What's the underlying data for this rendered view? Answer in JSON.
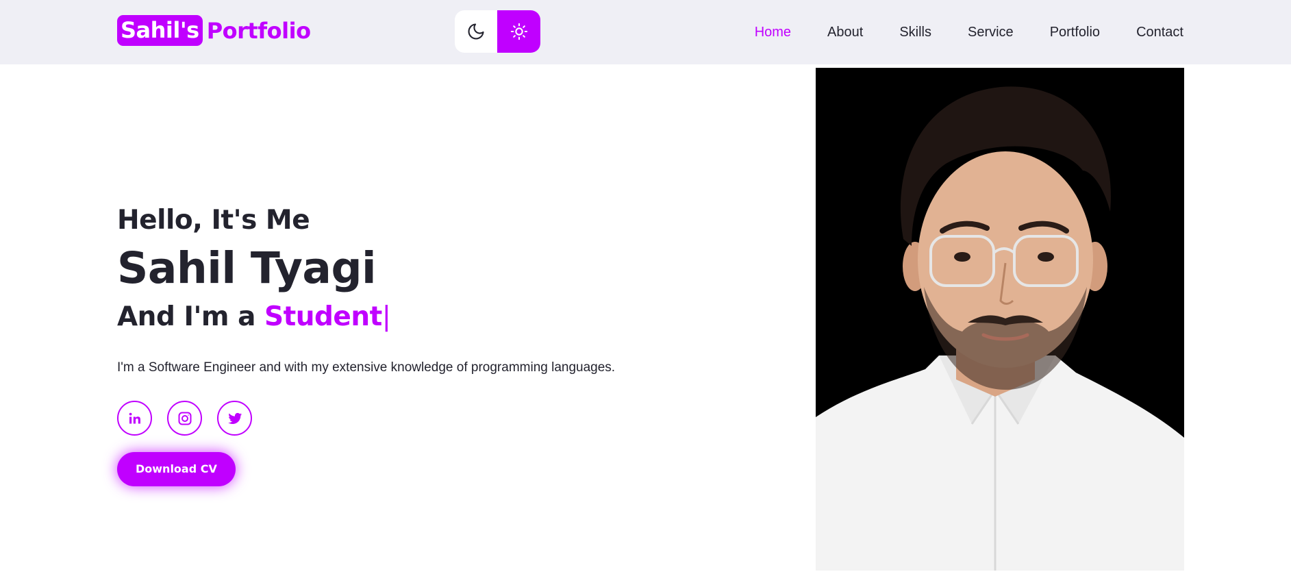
{
  "header": {
    "logo_badge": "Sahil's",
    "logo_text": "Portfolio",
    "theme_toggle": {
      "dark_icon": "moon-icon",
      "light_icon": "sun-icon",
      "active": "light"
    },
    "nav": [
      {
        "label": "Home",
        "active": true
      },
      {
        "label": "About",
        "active": false
      },
      {
        "label": "Skills",
        "active": false
      },
      {
        "label": "Service",
        "active": false
      },
      {
        "label": "Portfolio",
        "active": false
      },
      {
        "label": "Contact",
        "active": false
      }
    ]
  },
  "hero": {
    "greeting": "Hello, It's Me",
    "name": "Sahil Tyagi",
    "role_prefix": "And I'm a",
    "role_highlight": "Student",
    "description": "I'm a Software Engineer and with my extensive knowledge of programming languages.",
    "socials": [
      {
        "icon": "linkedin-icon"
      },
      {
        "icon": "instagram-icon"
      },
      {
        "icon": "twitter-icon"
      }
    ],
    "cta_label": "Download CV"
  },
  "colors": {
    "accent": "#c000ff",
    "text": "#23232e",
    "navbar_bg": "#efeff5",
    "background": "#ffffff",
    "portrait_bg": "#000000"
  }
}
